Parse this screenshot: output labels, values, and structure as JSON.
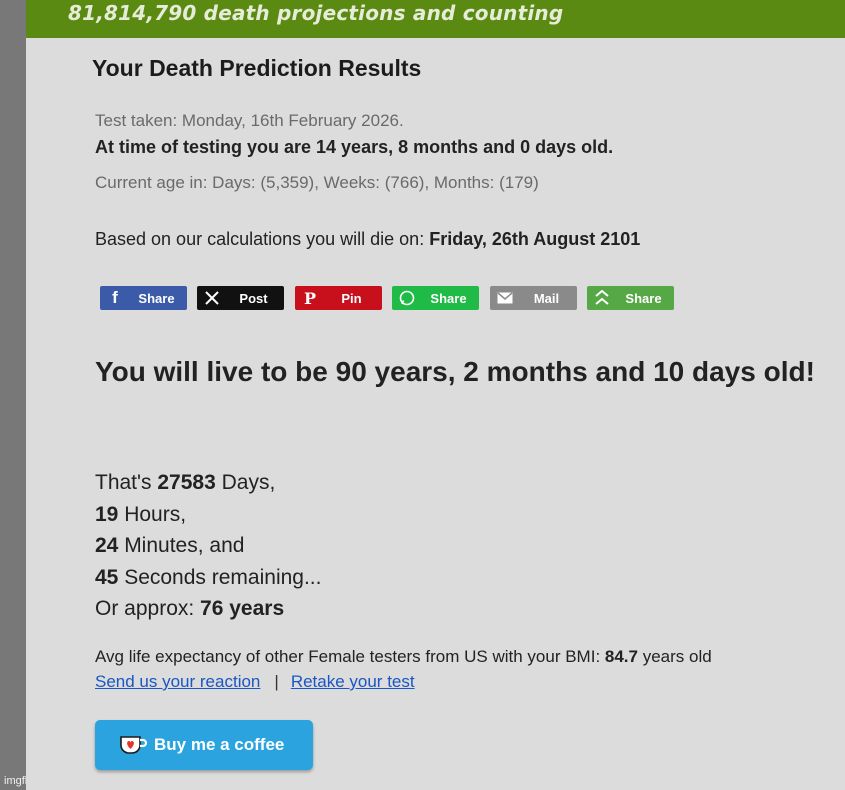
{
  "banner": {
    "text": "81,814,790 death projections and counting"
  },
  "results": {
    "title": "Your Death Prediction Results",
    "test_taken": "Test taken: Monday, 16th February 2026.",
    "age_at_test": "At time of testing you are 14 years, 8 months and 0 days old.",
    "current_age": "Current age in: Days: (5,359), Weeks: (766), Months: (179)",
    "die_prefix": "Based on our calculations you will die on: ",
    "die_date": "Friday, 26th August 2101"
  },
  "share": [
    {
      "label": "Share",
      "icon": "f",
      "color": "#3b5ba8"
    },
    {
      "label": "Post",
      "icon": "X",
      "color": "#111111"
    },
    {
      "label": "Pin",
      "icon": "P",
      "color": "#c8101c"
    },
    {
      "label": "Share",
      "icon": "whatsapp",
      "color": "#1fbb46"
    },
    {
      "label": "Mail",
      "icon": "mail",
      "color": "#8a8a8a"
    },
    {
      "label": "Share",
      "icon": "more",
      "color": "#55a845"
    }
  ],
  "lifespan": {
    "headline": "You will live to be 90 years, 2 months and 10 days old!"
  },
  "countdown": {
    "days_prefix": "That's ",
    "days": "27583",
    "days_suffix": " Days,",
    "hours": "19",
    "hours_suffix": " Hours,",
    "minutes": "24",
    "minutes_suffix": " Minutes, and",
    "seconds": "45",
    "seconds_suffix": " Seconds remaining...",
    "approx_prefix": "Or approx: ",
    "approx": "76 years"
  },
  "avg": {
    "prefix": "Avg life expectancy of other Female testers from US with your BMI: ",
    "value": "84.7",
    "suffix": " years old"
  },
  "links": {
    "reaction": "Send us your reaction",
    "separator": "|",
    "retake": "Retake your test"
  },
  "coffee": {
    "label": "Buy me a coffee"
  },
  "watermark": "imgflip.com"
}
